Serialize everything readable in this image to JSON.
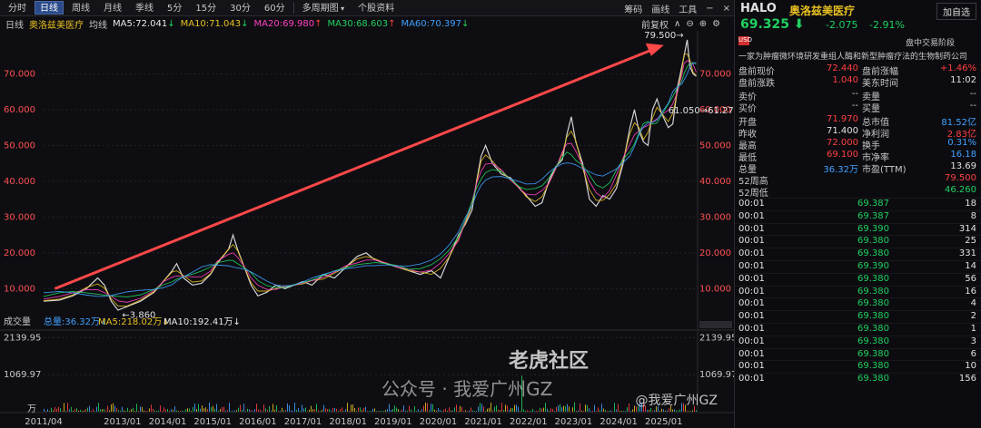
{
  "toolbar": {
    "tabs": [
      "分时",
      "日线",
      "周线",
      "月线",
      "季线",
      "5分",
      "15分",
      "30分",
      "60分",
      "多周期图",
      "个股资料"
    ],
    "active": 1,
    "right": [
      "筹码",
      "画线",
      "工具"
    ],
    "window_icons": [
      "−",
      "×"
    ]
  },
  "infobar": {
    "period": "日线",
    "name": "奥洛兹美医疗",
    "avg": "均线",
    "ma": [
      {
        "label": "MA5:72.041",
        "arrow": "↓",
        "color": "#e8e8e8"
      },
      {
        "label": "MA10:71.043",
        "arrow": "↓",
        "color": "#e8c020"
      },
      {
        "label": "MA20:69.980",
        "arrow": "↑",
        "color": "#ff40c0"
      },
      {
        "label": "MA30:68.603",
        "arrow": "↑",
        "color": "#20d060"
      },
      {
        "label": "MA60:70.397",
        "arrow": "↓",
        "color": "#40a0ff"
      }
    ],
    "adjust": "前复权"
  },
  "volbar": {
    "title": "成交量",
    "total": "总量:36.32万",
    "ma5": "MA5:218.02万",
    "ma10": "MA10:192.41万"
  },
  "chart_data": {
    "type": "line",
    "yticks": [
      10,
      20,
      30,
      40,
      50,
      60,
      70
    ],
    "ytick_labels_left": [
      "10.000",
      "20.000",
      "30.000",
      "40.000",
      "50.000",
      "60.000",
      "70.000"
    ],
    "ytick_labels_right": [
      "10.000",
      "20.000",
      "30.000",
      "40.000",
      "50.000",
      "60.000",
      "70.000"
    ],
    "ylim": [
      3,
      81
    ],
    "xlabels": [
      "2011/04",
      "2013/01",
      "2014/01",
      "2015/01",
      "2016/01",
      "2017/01",
      "2018/01",
      "2019/01",
      "2020/01",
      "2021/01",
      "2022/01",
      "2023/01",
      "2024/01",
      "2025/01"
    ],
    "xlabel_years": [
      2011.25,
      2013,
      2014,
      2015,
      2016,
      2017,
      2018,
      2019,
      2020,
      2021,
      2022,
      2023,
      2024,
      2025
    ],
    "xlim": [
      2011.25,
      2025.75
    ],
    "price": [
      [
        2011.25,
        6.5
      ],
      [
        2011.6,
        6.8
      ],
      [
        2011.9,
        8
      ],
      [
        2012.2,
        10
      ],
      [
        2012.45,
        13
      ],
      [
        2012.6,
        11
      ],
      [
        2012.75,
        6.5
      ],
      [
        2012.9,
        4
      ],
      [
        2013.1,
        5
      ],
      [
        2013.4,
        6.5
      ],
      [
        2013.7,
        9
      ],
      [
        2013.9,
        12
      ],
      [
        2014.1,
        15
      ],
      [
        2014.2,
        17
      ],
      [
        2014.35,
        13
      ],
      [
        2014.55,
        11
      ],
      [
        2014.75,
        11.5
      ],
      [
        2014.95,
        14
      ],
      [
        2015.1,
        17
      ],
      [
        2015.35,
        21
      ],
      [
        2015.45,
        25
      ],
      [
        2015.55,
        21
      ],
      [
        2015.7,
        16
      ],
      [
        2015.85,
        11
      ],
      [
        2016.0,
        8
      ],
      [
        2016.2,
        9
      ],
      [
        2016.4,
        11
      ],
      [
        2016.6,
        10
      ],
      [
        2016.8,
        11
      ],
      [
        2017.0,
        12
      ],
      [
        2017.2,
        11
      ],
      [
        2017.45,
        14
      ],
      [
        2017.7,
        13
      ],
      [
        2017.95,
        16
      ],
      [
        2018.2,
        19
      ],
      [
        2018.4,
        20
      ],
      [
        2018.6,
        18
      ],
      [
        2018.85,
        17
      ],
      [
        2019.1,
        16
      ],
      [
        2019.35,
        15
      ],
      [
        2019.6,
        14
      ],
      [
        2019.85,
        15
      ],
      [
        2020.05,
        13
      ],
      [
        2020.25,
        19
      ],
      [
        2020.45,
        25
      ],
      [
        2020.6,
        28
      ],
      [
        2020.75,
        32
      ],
      [
        2020.85,
        40
      ],
      [
        2020.95,
        47
      ],
      [
        2021.05,
        50
      ],
      [
        2021.2,
        45
      ],
      [
        2021.4,
        42
      ],
      [
        2021.6,
        41
      ],
      [
        2021.8,
        38
      ],
      [
        2021.95,
        36
      ],
      [
        2022.15,
        33
      ],
      [
        2022.3,
        34
      ],
      [
        2022.45,
        40
      ],
      [
        2022.6,
        44
      ],
      [
        2022.75,
        46
      ],
      [
        2022.85,
        53
      ],
      [
        2022.95,
        58
      ],
      [
        2023.05,
        51
      ],
      [
        2023.2,
        45
      ],
      [
        2023.35,
        35
      ],
      [
        2023.5,
        33
      ],
      [
        2023.65,
        36
      ],
      [
        2023.8,
        35
      ],
      [
        2023.95,
        38
      ],
      [
        2024.1,
        45
      ],
      [
        2024.25,
        55
      ],
      [
        2024.35,
        60
      ],
      [
        2024.45,
        54
      ],
      [
        2024.55,
        51
      ],
      [
        2024.65,
        50
      ],
      [
        2024.75,
        60
      ],
      [
        2024.85,
        63
      ],
      [
        2024.95,
        59
      ],
      [
        2025.1,
        55
      ],
      [
        2025.2,
        56
      ],
      [
        2025.3,
        66
      ],
      [
        2025.4,
        72
      ],
      [
        2025.45,
        75
      ],
      [
        2025.52,
        79.5
      ],
      [
        2025.58,
        72
      ],
      [
        2025.65,
        70
      ],
      [
        2025.72,
        69.3
      ]
    ],
    "annotations": {
      "high": "79.500",
      "high_x": 2025.52,
      "high_y": 79.5,
      "low": "3.860",
      "low_x": 2012.95,
      "low_y": 3.86,
      "mid": "61.050",
      "mid2": "61.27"
    },
    "volume": {
      "yticks": [
        1069.97,
        2139.95
      ],
      "ytick_labels": [
        "1069.97",
        "2139.95"
      ],
      "unit": "万",
      "ylim": [
        0,
        2200
      ]
    }
  },
  "side": {
    "symbol": "HALO",
    "name": "奥洛兹美医疗",
    "price": "69.325",
    "arrow": "⬇",
    "change": "-2.075",
    "pct": "-2.91%",
    "watch": "加自选",
    "badge": "USD",
    "phase": "盘中交易阶段",
    "desc": "一家为肿瘤微环境研发重组人酶和新型肿瘤疗法的生物制药公司",
    "pre": [
      [
        "盘前现价",
        "72.440",
        "盘前涨幅",
        "+1.46%"
      ],
      [
        "盘前涨跌",
        "1.040",
        "美东时间",
        "11:02"
      ]
    ],
    "bidask": [
      [
        "卖价",
        "--",
        "卖量",
        "--"
      ],
      [
        "买价",
        "--",
        "买量",
        "--"
      ]
    ],
    "stats": [
      [
        "开盘",
        "71.970",
        "总市值",
        "81.52亿"
      ],
      [
        "昨收",
        "71.400",
        "净利润",
        "2.83亿"
      ],
      [
        "最高",
        "72.000",
        "换手",
        "0.31%"
      ],
      [
        "最低",
        "69.100",
        "市净率",
        "16.18"
      ],
      [
        "总量",
        "36.32万",
        "市盈(TTM)",
        "13.69"
      ],
      [
        "52周高",
        "",
        "",
        "79.500"
      ],
      [
        "52周低",
        "",
        "",
        "46.260"
      ]
    ],
    "ticks": [
      [
        "00:01",
        "69.387",
        "18"
      ],
      [
        "00:01",
        "69.387",
        "8"
      ],
      [
        "00:01",
        "69.390",
        "314"
      ],
      [
        "00:01",
        "69.380",
        "25"
      ],
      [
        "00:01",
        "69.380",
        "331"
      ],
      [
        "00:01",
        "69.390",
        "14"
      ],
      [
        "00:01",
        "69.380",
        "56"
      ],
      [
        "00:01",
        "69.380",
        "16"
      ],
      [
        "00:01",
        "69.380",
        "4"
      ],
      [
        "00:01",
        "69.380",
        "2"
      ],
      [
        "00:01",
        "69.380",
        "1"
      ],
      [
        "00:01",
        "69.380",
        "3"
      ],
      [
        "00:01",
        "69.380",
        "6"
      ],
      [
        "00:01",
        "69.380",
        "10"
      ],
      [
        "00:01",
        "69.380",
        "156"
      ]
    ]
  },
  "watermark": {
    "a": "公众号 · 我爱广州GZ",
    "b": "老虎社区",
    "c": "@我爱广州GZ"
  }
}
